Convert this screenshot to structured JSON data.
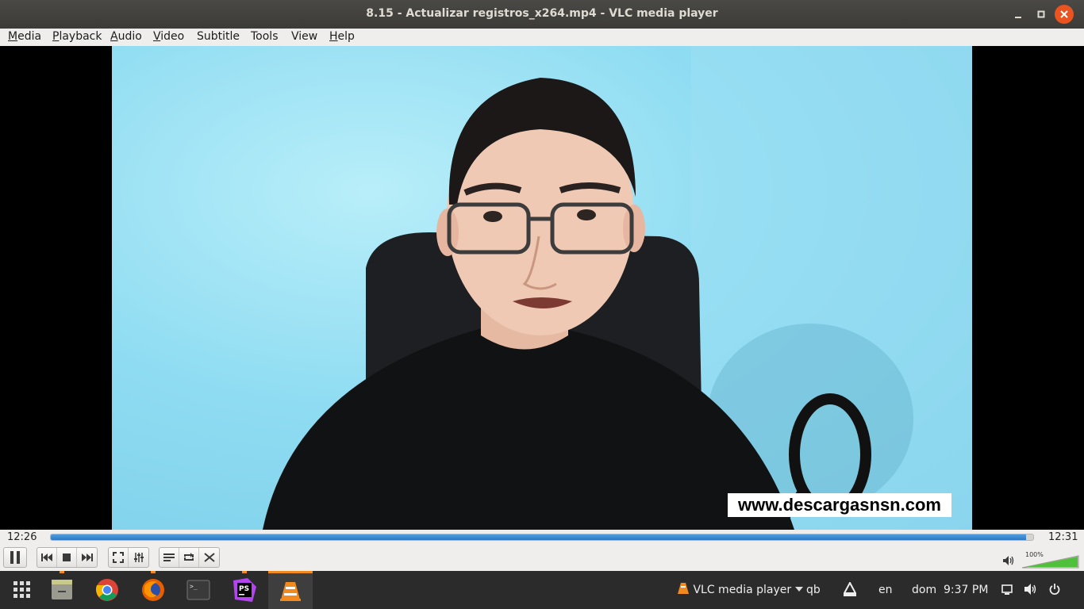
{
  "window": {
    "title": "8.15 - Actualizar registros_x264.mp4 - VLC media player"
  },
  "menu": [
    {
      "label": "Media",
      "mnemonic": "M",
      "rest": "edia"
    },
    {
      "label": "Playback",
      "mnemonic": "P",
      "rest": "layback"
    },
    {
      "label": "Audio",
      "mnemonic": "A",
      "rest": "udio"
    },
    {
      "label": "Video",
      "mnemonic": "V",
      "rest": "ideo"
    },
    {
      "label": "Subtitle",
      "mnemonic": "",
      "rest": "Subtitle"
    },
    {
      "label": "Tools",
      "mnemonic": "",
      "rest": "Tools"
    },
    {
      "label": "View",
      "mnemonic": "",
      "rest": "View"
    },
    {
      "label": "Help",
      "mnemonic": "H",
      "rest": "elp"
    }
  ],
  "video": {
    "watermark": "www.descargasnsn.com"
  },
  "player": {
    "time_elapsed": "12:26",
    "time_total": "12:31",
    "progress_fraction": 0.993,
    "volume_label": "100%",
    "volume_fraction": 1.0,
    "buttons": [
      "pause-icon",
      "previous-icon",
      "stop-icon",
      "next-icon",
      "fullscreen-icon",
      "extended-settings-icon",
      "playlist-icon",
      "loop-icon",
      "shuffle-icon"
    ]
  },
  "taskbar": {
    "apps": [
      "app-grid-icon",
      "files-icon",
      "chrome-icon",
      "firefox-icon",
      "terminal-icon",
      "phpstorm-icon",
      "vlc-icon"
    ],
    "active_app_label": "VLC media player",
    "tray_qb": "qb",
    "tray_lang": "en",
    "clock_day": "dom",
    "clock_time": "9:37 PM",
    "colors": {
      "accent": "#f0891e",
      "close": "#e95420",
      "seek": "#2f78c4"
    }
  }
}
